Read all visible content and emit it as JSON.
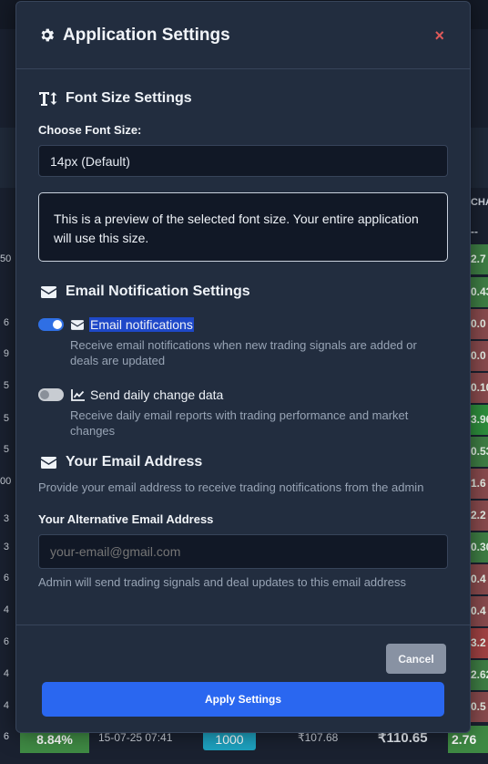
{
  "background": {
    "left_numbers": [
      "50",
      "6",
      "9",
      "5",
      "5",
      "5",
      "00",
      "3",
      "3",
      "6",
      "4",
      "6",
      "4",
      "4",
      "6"
    ],
    "right_values": [
      "2.7",
      "0.43",
      "0.0",
      "0.0",
      "0.10",
      "3.96",
      "0.53",
      "1.6",
      "2.2",
      "0.30",
      "0.4",
      "0.4",
      "3.2",
      "2.62",
      "0.5"
    ],
    "right_header": "CHA",
    "right_dashes": "--",
    "bottom_row": {
      "left": "6",
      "percent": "8.84%",
      "datetime": "15-07-25 07:41",
      "qty": "1000",
      "price1": "₹107.68",
      "price2": "₹110.65",
      "change": "2.76"
    }
  },
  "modal": {
    "title": "Application Settings",
    "close_symbol": "×",
    "font_section": {
      "title": "Font Size Settings",
      "choose_label": "Choose Font Size:",
      "selected": "14px (Default)",
      "preview_text": "This is a preview of the selected font size. Your entire application will use this size."
    },
    "email_section": {
      "title": "Email Notification Settings",
      "toggles": [
        {
          "label": "Email notifications",
          "on": true,
          "description": "Receive email notifications when new trading signals are added or deals are updated"
        },
        {
          "label": "Send daily change data",
          "on": false,
          "description": "Receive daily email reports with trading performance and market changes"
        }
      ]
    },
    "address_section": {
      "title": "Your Email Address",
      "subtitle": "Provide your email address to receive trading notifications from the admin",
      "field_label": "Your Alternative Email Address",
      "placeholder": "your-email@gmail.com",
      "help": "Admin will send trading signals and deal updates to this email address"
    },
    "buttons": {
      "cancel": "Cancel",
      "apply": "Apply Settings"
    }
  },
  "colors": {
    "accent": "#2a67f0",
    "close": "#e05a5a",
    "modal_bg": "#222d3f",
    "positive": "#3f7f45",
    "negative": "#8a4b4e"
  }
}
